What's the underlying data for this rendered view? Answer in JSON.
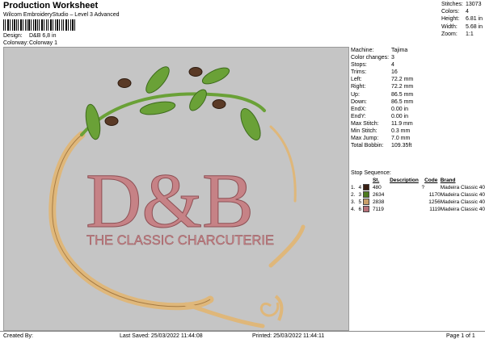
{
  "header": {
    "title": "Production Worksheet",
    "subtitle": "Wilcom EmbroideryStudio – Level 3 Advanced",
    "barcode_label": "barcode",
    "design_label": "Design:",
    "design_value": "D&B 6,8 in",
    "colorway_label": "Colorway:",
    "colorway_value": "Colorway 1"
  },
  "stats": [
    {
      "k": "Stitches:",
      "v": "13073"
    },
    {
      "k": "Colors:",
      "v": "4"
    },
    {
      "k": "Height:",
      "v": "6.81 in"
    },
    {
      "k": "Width:",
      "v": "5.68 in"
    },
    {
      "k": "Zoom:",
      "v": "1:1"
    }
  ],
  "machine": [
    {
      "k": "Machine:",
      "v": "Tajima"
    },
    {
      "k": "Color changes:",
      "v": "3"
    },
    {
      "k": "Stops:",
      "v": "4"
    },
    {
      "k": "Trims:",
      "v": "16"
    },
    {
      "k": "Left:",
      "v": "72.2 mm"
    },
    {
      "k": "Right:",
      "v": "72.2 mm"
    },
    {
      "k": "Up:",
      "v": "86.5 mm"
    },
    {
      "k": "Down:",
      "v": "86.5 mm"
    },
    {
      "k": "EndX:",
      "v": "0.00 in"
    },
    {
      "k": "EndY:",
      "v": "0.00 in"
    },
    {
      "k": "Max Stitch:",
      "v": "11.9 mm"
    },
    {
      "k": "Min Stitch:",
      "v": "0.3 mm"
    },
    {
      "k": "Max Jump:",
      "v": "7.0 mm"
    },
    {
      "k": "Total Bobbin:",
      "v": "109.35ft"
    }
  ],
  "stop_sequence": {
    "label": "Stop Sequence:",
    "columns": [
      "",
      "",
      "St.",
      "Description",
      "Code",
      "Brand"
    ],
    "rows": [
      {
        "n": "1.",
        "c": "4",
        "color": "#3a1f12",
        "st": "480",
        "desc": "?",
        "code": "",
        "brand": "Madeira Classic 40"
      },
      {
        "n": "2.",
        "c": "3",
        "color": "#4d7a1e",
        "st": "2634",
        "desc": "",
        "code": "1170",
        "brand": "Madeira Classic 40"
      },
      {
        "n": "3.",
        "c": "5",
        "color": "#c9a06a",
        "st": "2838",
        "desc": "",
        "code": "1256",
        "brand": "Madeira Classic 40"
      },
      {
        "n": "4.",
        "c": "6",
        "color": "#b87179",
        "st": "7119",
        "desc": "",
        "code": "1119",
        "brand": "Madeira Classic 40"
      }
    ]
  },
  "logo": {
    "monogram": "D&B",
    "tagline": "THE CLASSIC CHARCUTERIE",
    "colors": {
      "pink": "#c68286",
      "gold": "#dfb77a",
      "leaf": "#6aa137",
      "bean": "#5a3a26"
    }
  },
  "footer": {
    "created": "Created By:",
    "saved": "Last Saved: 25/03/2022 11:44:08",
    "printed": "Printed: 25/03/2022 11:44:11",
    "page": "Page 1 of 1"
  }
}
